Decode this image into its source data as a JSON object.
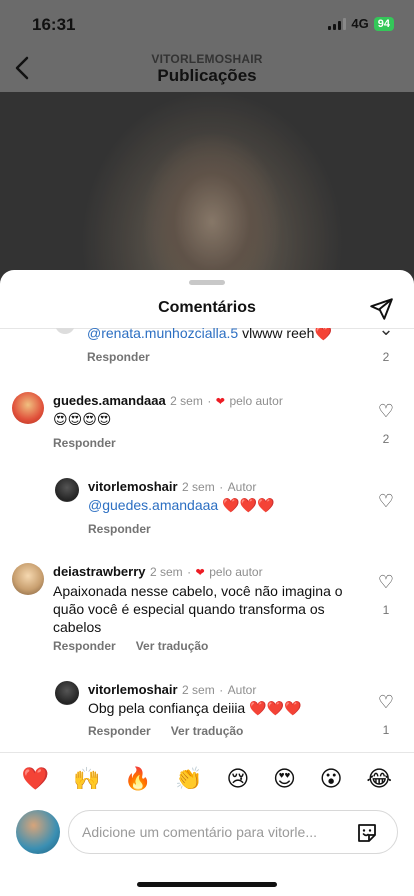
{
  "status": {
    "time": "16:31",
    "network": "4G",
    "battery": "94"
  },
  "topnav": {
    "username": "VITORLEMOSHAIR",
    "title": "Publicações"
  },
  "sheet": {
    "title": "Comentários"
  },
  "comments": [
    {
      "mention": "@renata.munhozcialla.5",
      "text": " vlwww reeh",
      "text_emoji": "❤️",
      "reply": "Responder",
      "likes": "2"
    },
    {
      "username": "guedes.amandaaa",
      "time": "2 sem",
      "liked_by": "pelo autor",
      "text": "😍😍😍😍",
      "reply": "Responder",
      "likes": "2"
    },
    {
      "username": "vitorlemoshair",
      "time": "2 sem",
      "role": "Autor",
      "mention": "@guedes.amandaaa",
      "text": " ❤️❤️❤️",
      "reply": "Responder"
    },
    {
      "username": "deiastrawberry",
      "time": "2 sem",
      "liked_by": "pelo autor",
      "text": "Apaixonada nesse cabelo, você não imagina o quão você é especial quando transforma os cabelos",
      "reply": "Responder",
      "translate": "Ver tradução",
      "likes": "1"
    },
    {
      "username": "vitorlemoshair",
      "time": "2 sem",
      "role": "Autor",
      "text": "Obg pela confiança deiiia ❤️❤️❤️",
      "reply": "Responder",
      "translate": "Ver tradução",
      "likes": "1"
    }
  ],
  "emoji_bar": [
    "❤️",
    "🙌",
    "🔥",
    "👏",
    "😢",
    "😍",
    "😮",
    "😂"
  ],
  "input": {
    "placeholder": "Adicione um comentário para vitorle..."
  },
  "colors": {
    "like_red": "#ed1c24",
    "mention_blue": "#2c6fc2",
    "battery_green": "#34c759"
  }
}
